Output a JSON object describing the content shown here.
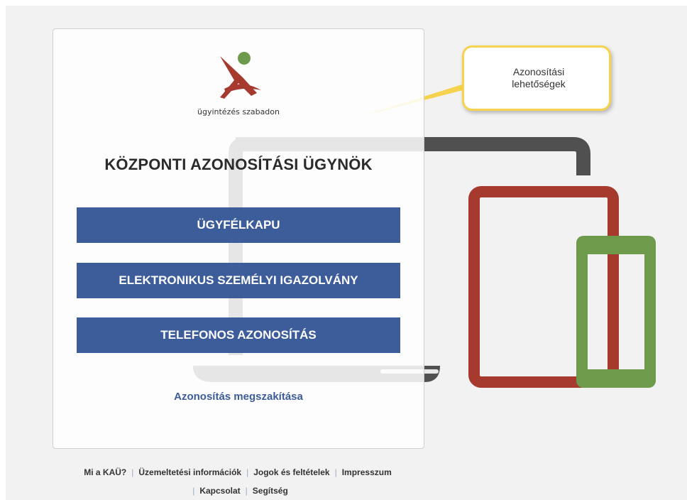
{
  "brand": {
    "logo_tagline": "ügyintézés szabadon"
  },
  "login": {
    "title": "KÖZPONTI AZONOSÍTÁSI ÜGYNÖK",
    "buttons": [
      {
        "label": "ÜGYFÉLKAPU"
      },
      {
        "label": "ELEKTRONIKUS SZEMÉLYI IGAZOLVÁNY"
      },
      {
        "label": "TELEFONOS AZONOSÍTÁS"
      }
    ],
    "cancel_link": "Azonosítás megszakítása"
  },
  "tooltip": {
    "line1": "Azonosítási",
    "line2": "lehetőségek"
  },
  "footer": {
    "links": [
      "Mi a KAÜ?",
      "Üzemeltetési információk",
      "Jogok és feltételek",
      "Impresszum",
      "Kapcsolat",
      "Segítség"
    ]
  },
  "colors": {
    "button": "#3c5c9a",
    "laptop": "#505050",
    "tablet": "#a63a2f",
    "phone": "#6e9a4c",
    "tooltip_border": "#f6d34e"
  }
}
